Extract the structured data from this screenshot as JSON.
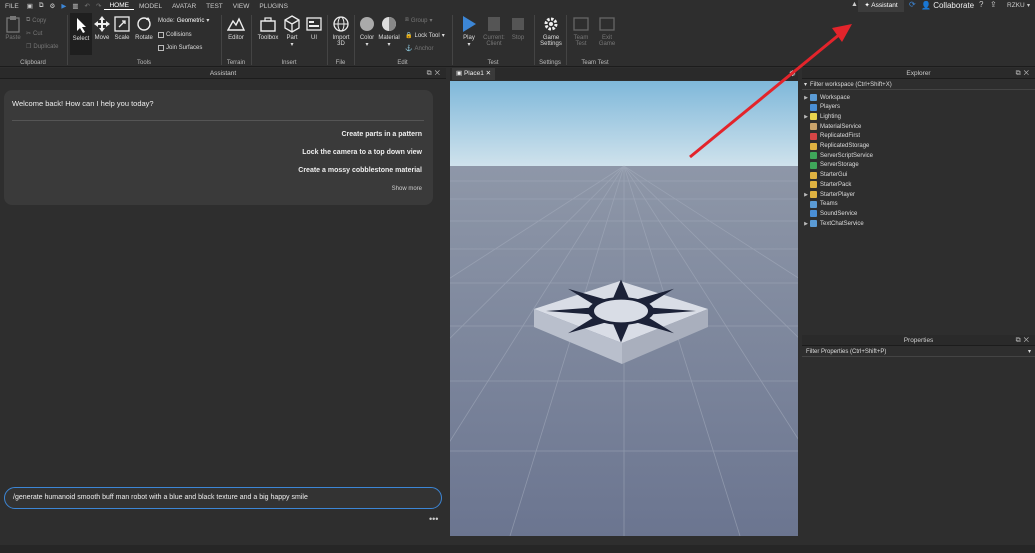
{
  "menu": {
    "file": "FILE",
    "tabs": [
      "HOME",
      "MODEL",
      "AVATAR",
      "TEST",
      "VIEW",
      "PLUGINS"
    ],
    "assistant": "Assistant",
    "collaborate": "Collaborate",
    "user": "RZKU"
  },
  "ribbon": {
    "clipboard": {
      "paste": "Paste",
      "copy": "Copy",
      "cut": "Cut",
      "duplicate": "Duplicate",
      "label": "Clipboard"
    },
    "tools": {
      "select": "Select",
      "move": "Move",
      "scale": "Scale",
      "rotate": "Rotate",
      "mode_label": "Mode:",
      "mode_value": "Geometric",
      "collisions": "Collisions",
      "join_surfaces": "Join Surfaces",
      "label": "Tools"
    },
    "terrain": {
      "editor": "Editor",
      "label": "Terrain"
    },
    "insert": {
      "toolbox": "Toolbox",
      "part": "Part",
      "ui": "UI",
      "label": "Insert"
    },
    "file": {
      "import_line1": "Import",
      "import_line2": "3D",
      "label": "File"
    },
    "edit": {
      "color": "Color",
      "material": "Material",
      "group": "Group",
      "lock_tool": "Lock Tool",
      "anchor": "Anchor",
      "label": "Edit"
    },
    "test": {
      "play": "Play",
      "current_line1": "Current:",
      "current_line2": "Client",
      "stop": "Stop",
      "label": "Test"
    },
    "settings": {
      "line1": "Game",
      "line2": "Settings",
      "label": "Settings"
    },
    "team_test": {
      "team_line1": "Team",
      "team_line2": "Test",
      "exit_line1": "Exit",
      "exit_line2": "Game",
      "label": "Team Test"
    }
  },
  "assistant_panel": {
    "title": "Assistant",
    "welcome": "Welcome back! How can I help you today?",
    "suggestions": [
      "Create parts in a pattern",
      "Lock the camera to a top down view",
      "Create a mossy cobblestone material"
    ],
    "show_more": "Show more",
    "prompt": "/generate humanoid smooth buff man robot with a blue and black texture and a big happy smile"
  },
  "viewport": {
    "tab": "Place1"
  },
  "explorer": {
    "title": "Explorer",
    "filter": "Filter workspace (Ctrl+Shift+X)",
    "items": [
      {
        "name": "Workspace",
        "expand": true,
        "color": "#5b9bd5"
      },
      {
        "name": "Players",
        "expand": false,
        "color": "#4a8fd6"
      },
      {
        "name": "Lighting",
        "expand": true,
        "color": "#e8d44d"
      },
      {
        "name": "MaterialService",
        "expand": false,
        "color": "#c9a36b"
      },
      {
        "name": "ReplicatedFirst",
        "expand": false,
        "color": "#d64545"
      },
      {
        "name": "ReplicatedStorage",
        "expand": false,
        "color": "#e0b341"
      },
      {
        "name": "ServerScriptService",
        "expand": false,
        "color": "#3fa65a"
      },
      {
        "name": "ServerStorage",
        "expand": false,
        "color": "#3fa65a"
      },
      {
        "name": "StarterGui",
        "expand": false,
        "color": "#e0b341"
      },
      {
        "name": "StarterPack",
        "expand": false,
        "color": "#e0b341"
      },
      {
        "name": "StarterPlayer",
        "expand": true,
        "color": "#e0b341"
      },
      {
        "name": "Teams",
        "expand": false,
        "color": "#5b9bd5"
      },
      {
        "name": "SoundService",
        "expand": false,
        "color": "#4a8fd6"
      },
      {
        "name": "TextChatService",
        "expand": true,
        "color": "#5b9bd5"
      }
    ]
  },
  "properties": {
    "title": "Properties",
    "filter": "Filter Properties (Ctrl+Shift+P)"
  },
  "colors": {
    "accent": "#3c86d6",
    "arrow": "#e3242b",
    "play": "#3c86d6"
  }
}
